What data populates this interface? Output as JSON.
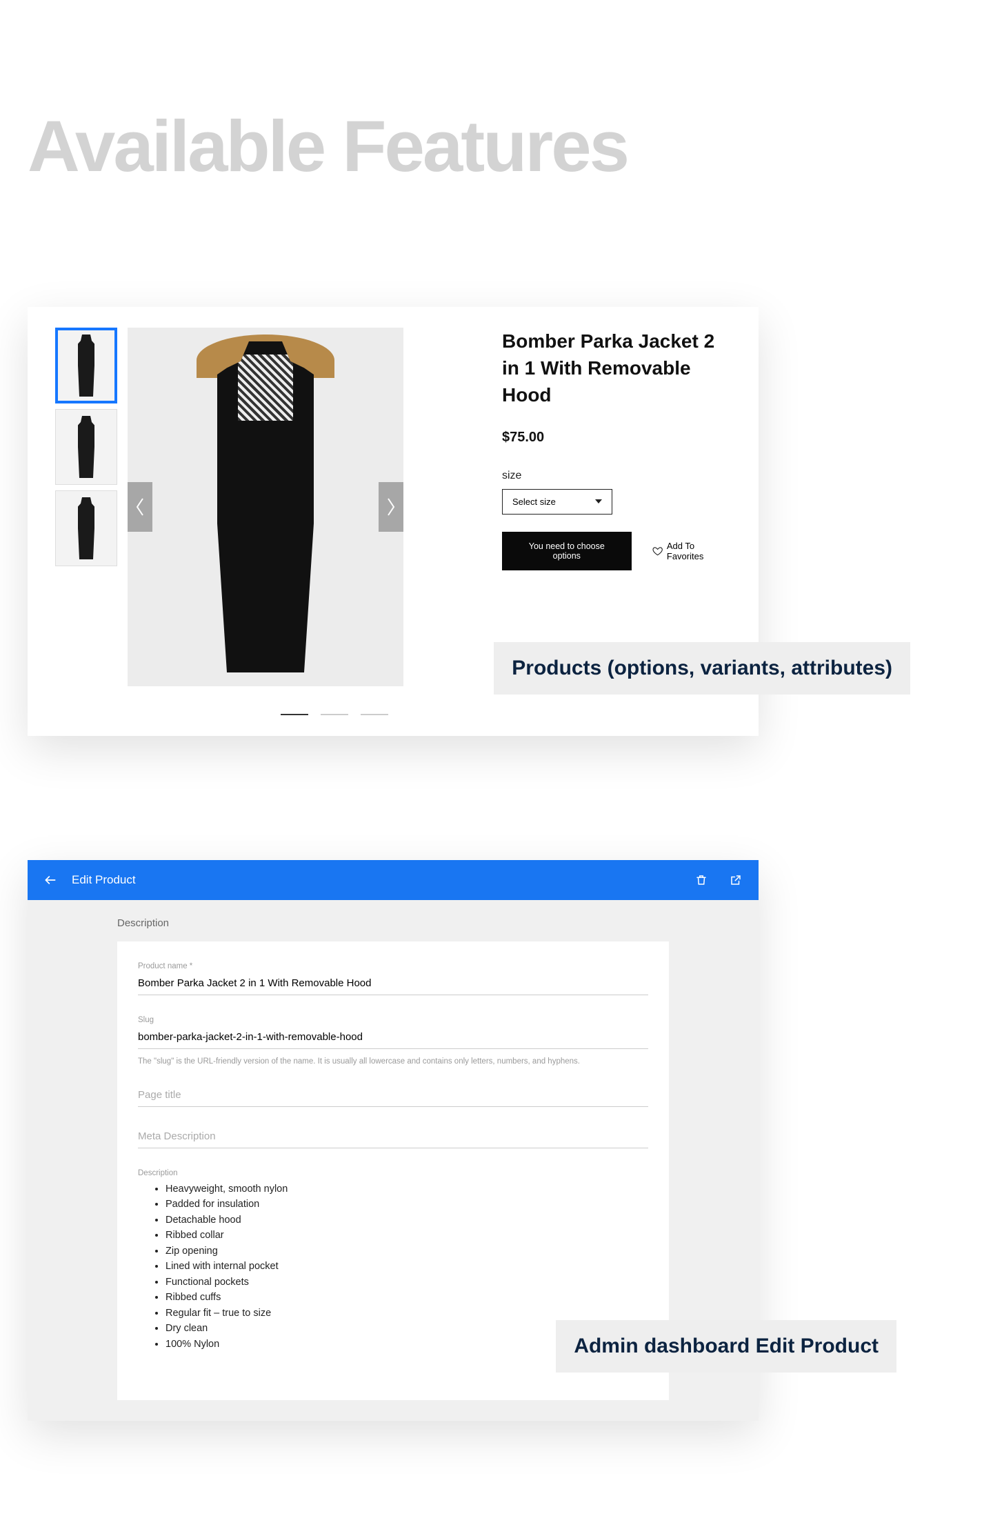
{
  "page_heading": "Available Features",
  "callouts": {
    "product": "Products (options, variants, attributes)",
    "admin": "Admin dashboard Edit Product"
  },
  "product": {
    "title": "Bomber Parka Jacket 2 in 1 With Removable Hood",
    "price": "$75.00",
    "option_label": "size",
    "select_placeholder": "Select size",
    "button_label": "You need to choose options",
    "favorite_label": "Add To Favorites"
  },
  "admin": {
    "header_title": "Edit Product",
    "section_label": "Description",
    "fields": {
      "name_label": "Product name *",
      "name_value": "Bomber Parka Jacket 2 in 1 With Removable Hood",
      "slug_label": "Slug",
      "slug_value": "bomber-parka-jacket-2-in-1-with-removable-hood",
      "slug_help": "The \"slug\" is the URL-friendly version of the name. It is usually all lowercase and contains only letters, numbers, and hyphens.",
      "page_title_placeholder": "Page title",
      "meta_desc_placeholder": "Meta Description",
      "desc_label": "Description",
      "desc_items": [
        "Heavyweight, smooth nylon",
        "Padded for insulation",
        "Detachable hood",
        "Ribbed collar",
        "Zip opening",
        "Lined with internal pocket",
        "Functional pockets",
        "Ribbed cuffs",
        "Regular fit – true to size",
        "Dry clean",
        "100% Nylon"
      ]
    }
  }
}
